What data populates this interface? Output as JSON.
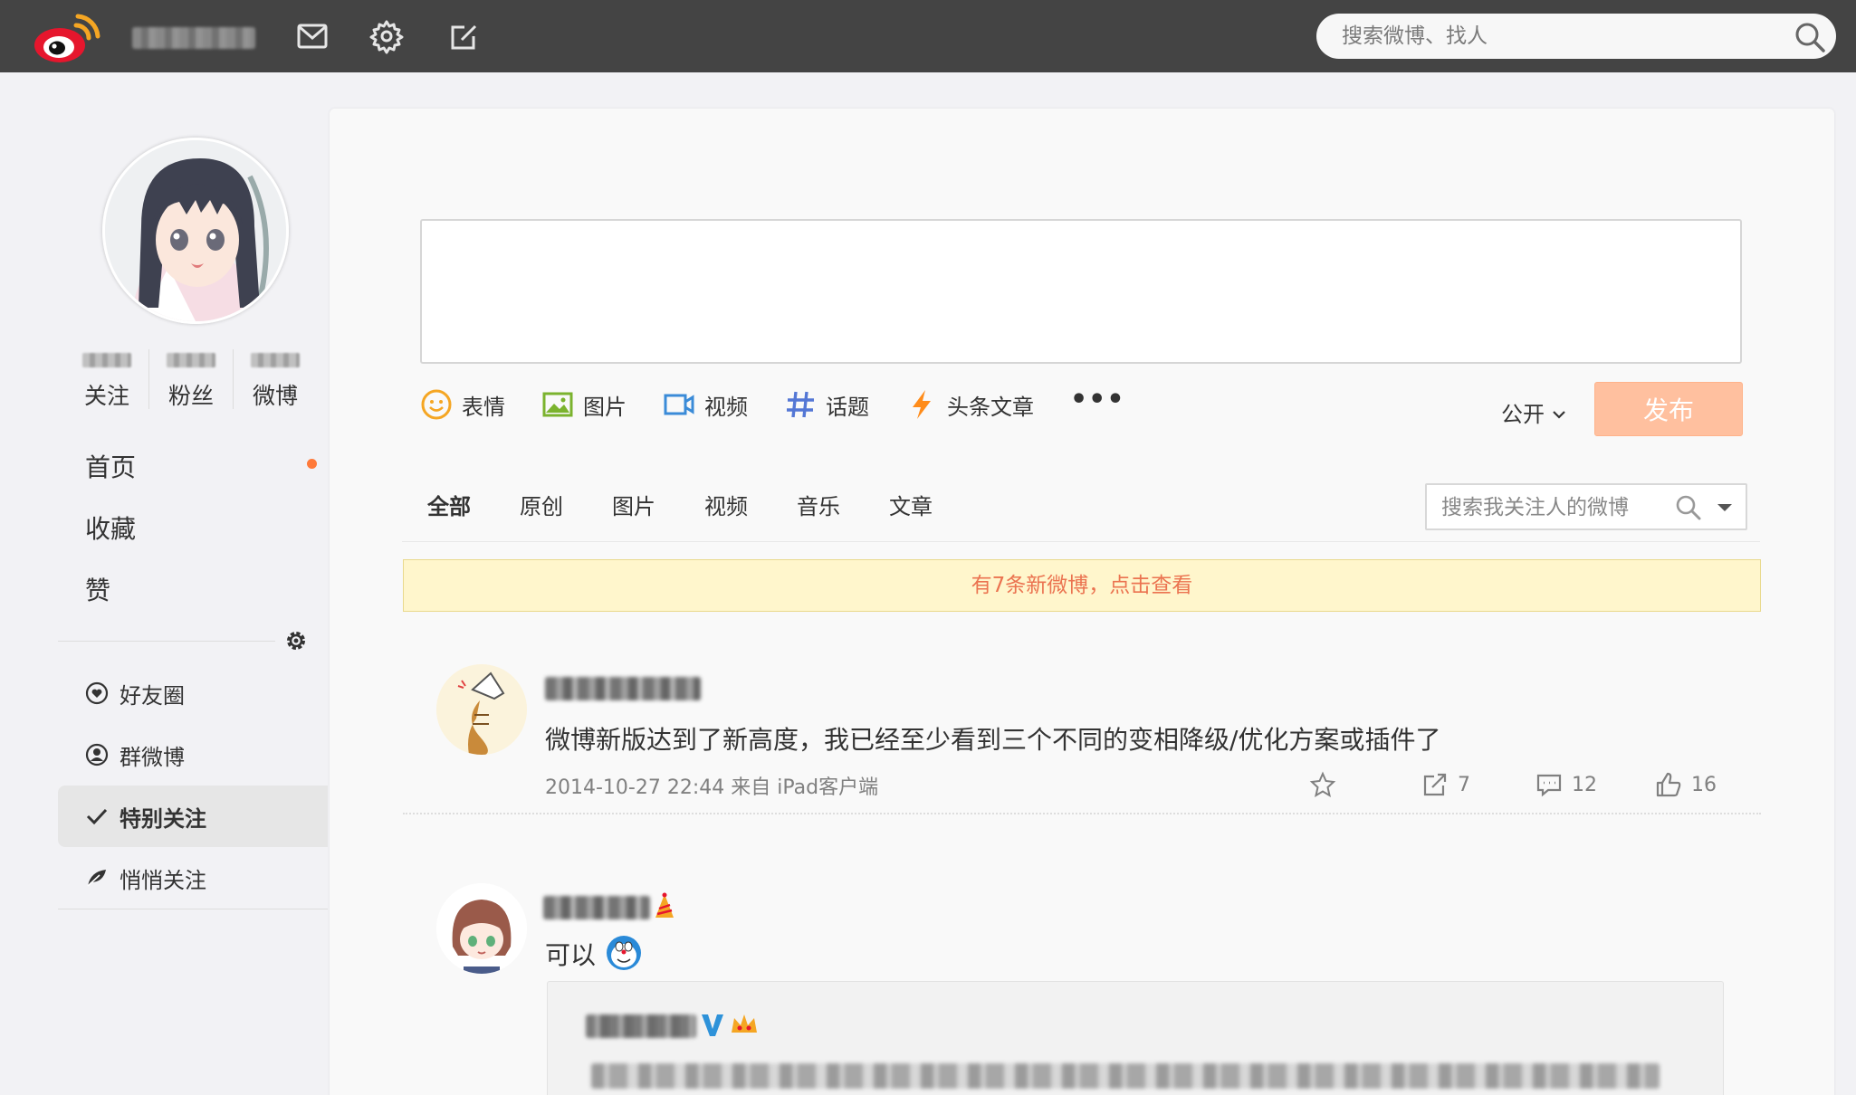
{
  "app": {
    "name": "微博"
  },
  "search": {
    "placeholder": "搜索微博、找人"
  },
  "profile": {
    "counts": [
      {
        "label": "关注"
      },
      {
        "label": "粉丝"
      },
      {
        "label": "微博"
      }
    ]
  },
  "nav": {
    "main": [
      {
        "label": "首页",
        "has_new": true
      },
      {
        "label": "收藏"
      },
      {
        "label": "赞"
      }
    ],
    "groups": [
      {
        "label": "好友圈",
        "icon": "heart-circle-icon",
        "active": false
      },
      {
        "label": "群微博",
        "icon": "user-circle-icon",
        "active": false
      },
      {
        "label": "特别关注",
        "icon": "check-icon",
        "active": true
      },
      {
        "label": "悄悄关注",
        "icon": "leaf-icon",
        "active": false
      }
    ]
  },
  "composer": {
    "tools": [
      {
        "label": "表情",
        "icon": "smile-icon"
      },
      {
        "label": "图片",
        "icon": "image-icon"
      },
      {
        "label": "视频",
        "icon": "video-icon"
      },
      {
        "label": "话题",
        "icon": "hash-icon"
      },
      {
        "label": "头条文章",
        "icon": "lightning-icon"
      }
    ],
    "more": "•••",
    "visibility": "公开",
    "publish_label": "发布"
  },
  "feed": {
    "tabs": [
      "全部",
      "原创",
      "图片",
      "视频",
      "音乐",
      "文章"
    ],
    "active_tab": "全部",
    "search_placeholder": "搜索我关注人的微博",
    "new_banner": "有7条新微博，点击查看",
    "posts": [
      {
        "text": "微博新版达到了新高度，我已经至少看到三个不同的变相降级/优化方案或插件了",
        "meta": "2014-10-27 22:44 来自 iPad客户端",
        "reposts": "7",
        "comments": "12",
        "likes": "16"
      },
      {
        "text": "可以"
      }
    ]
  },
  "colors": {
    "topbar": "#444444",
    "accent": "#eb7350",
    "publish_disabled": "#ffc09f",
    "banner_bg": "#fff6cc",
    "brand_red": "#e6162d",
    "brand_orange": "#f5a623"
  }
}
